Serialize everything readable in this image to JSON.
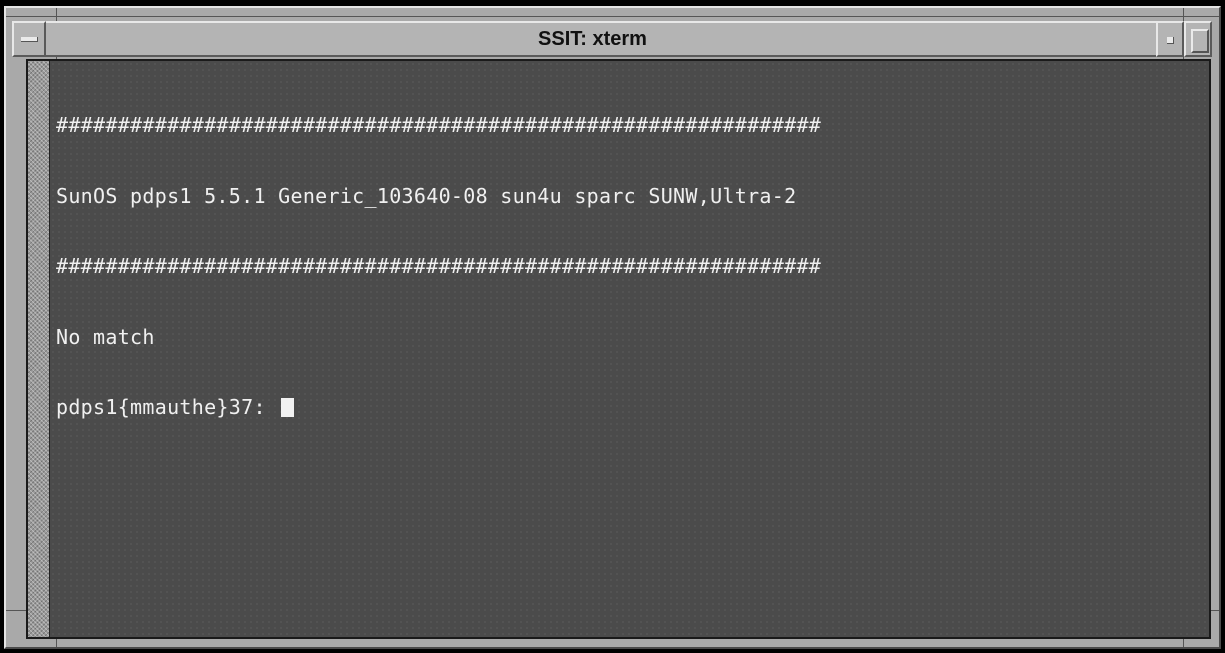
{
  "window": {
    "title": "SSIT: xterm"
  },
  "terminal": {
    "lines": [
      "##############################################################",
      "SunOS pdps1 5.5.1 Generic_103640-08 sun4u sparc SUNW,Ultra-2",
      "##############################################################",
      "No match"
    ],
    "prompt": "pdps1{mmauthe}37: "
  }
}
